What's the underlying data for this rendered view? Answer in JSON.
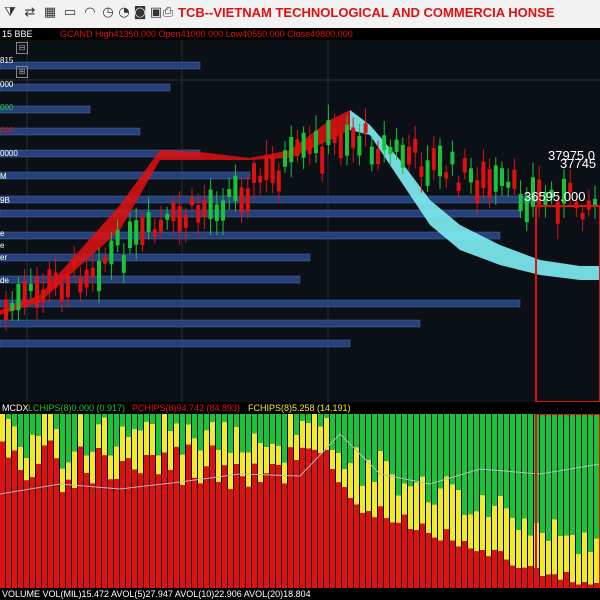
{
  "toolbar": {
    "title": "TCB--VIETNAM TECHNOLOGICAL AND COMMERCIA  HONSE",
    "icons": [
      "filter-icon",
      "exchange-icon",
      "grid-icon",
      "screen-icon",
      "wifi-icon",
      "clock-icon",
      "gauge-icon",
      "camera-icon",
      "save-icon",
      "print-icon",
      "calendar-icon",
      "plus-icon",
      "help-icon"
    ]
  },
  "chart_header": {
    "symbol": "15 BBE",
    "gcand": "GCAND High41350.000 Open41000.000 Low40550.000 Close40800.000"
  },
  "left_labels": [
    "815",
    "000",
    "000",
    "000",
    "0000",
    "M",
    "9B",
    "e",
    "e",
    "er",
    "de"
  ],
  "price_labels": [
    "37975.0",
    "37745",
    "36595.000"
  ],
  "indicator": {
    "name": "MCDX",
    "lchips": "LCHIPS(8)0.000 (0.917)",
    "pchips": "PCHIPS(8)94.742 (84.893)",
    "fchips": "FCHIPS(8)5.258 (14.191)"
  },
  "volume": {
    "text": "VOLUME VOL(MIL)15.472  AVOL(5)27.947  AVOL(10)22.906  AVOL(20)18.804"
  },
  "colors": {
    "up": "#19c43a",
    "down": "#e01010",
    "cloud_up": "#e01010",
    "cloud_down": "#7ef0f5",
    "lchips": "#19c43a",
    "pchips": "#e01010",
    "fchips": "#f0ea2a",
    "volume_profile": "#2b4a8c",
    "highlight_box": "#e01010"
  }
}
